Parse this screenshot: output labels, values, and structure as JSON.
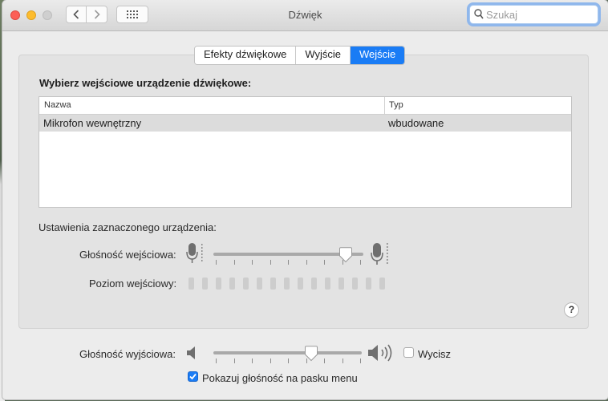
{
  "window": {
    "title": "Dźwięk"
  },
  "search": {
    "placeholder": "Szukaj",
    "value": ""
  },
  "tabs": [
    {
      "label": "Efekty dźwiękowe",
      "active": false
    },
    {
      "label": "Wyjście",
      "active": false
    },
    {
      "label": "Wejście",
      "active": true
    }
  ],
  "input_section": {
    "heading": "Wybierz wejściowe urządzenie dźwiękowe:",
    "columns": [
      "Nazwa",
      "Typ"
    ],
    "rows": [
      {
        "name": "Mikrofon wewnętrzny",
        "type": "wbudowane",
        "selected": true
      }
    ]
  },
  "device_settings": {
    "heading": "Ustawienia zaznaczonego urządzenia:",
    "input_volume_label": "Głośność wejściowa:",
    "input_volume_value": 0.9,
    "input_level_label": "Poziom wejściowy:",
    "input_level_segments": 15,
    "input_level_active": 0
  },
  "help_button": "?",
  "output": {
    "volume_label": "Głośność wyjściowa:",
    "volume_value": 0.66,
    "mute_label": "Wycisz",
    "mute_checked": false,
    "menu_bar_label": "Pokazuj głośność na pasku menu",
    "menu_bar_checked": true
  },
  "icons": {
    "back": "chevron-left-icon",
    "forward": "chevron-right-icon",
    "show_all": "grid-icon",
    "search": "search-icon",
    "mic_low": "microphone-low-icon",
    "mic_high": "microphone-high-icon",
    "speaker_low": "speaker-low-icon",
    "speaker_high": "speaker-high-icon"
  },
  "colors": {
    "accent": "#1a7cf5",
    "close": "#fc5f57",
    "minimize": "#fdbc2e"
  }
}
